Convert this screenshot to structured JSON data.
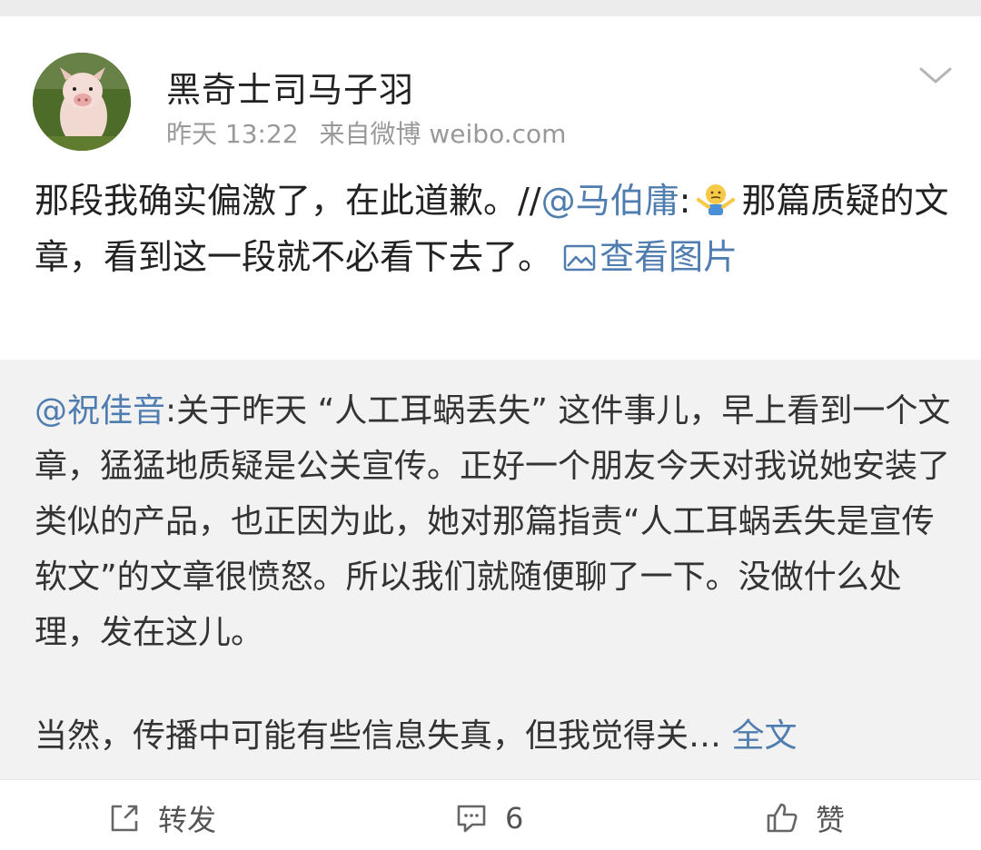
{
  "post": {
    "author": "黑奇士司马子羽",
    "time": "昨天 13:22",
    "source": "来自微博 weibo.com",
    "text_part1": "那段我确实偏激了，在此道歉。//",
    "mention": "@马伯庸",
    "colon": ":",
    "text_part2": "那篇质疑的文章，看到这一段就不必看下去了。",
    "view_image_label": "查看图片"
  },
  "repost": {
    "mention": "@祝佳音",
    "text": ":关于昨天 “人工耳蜗丢失” 这件事儿，早上看到一个文章，猛猛地质疑是公关宣传。正好一个朋友今天对我说她安装了类似的产品，也正因为此，她对那篇指责“人工耳蜗丢失是宣传软文”的文章很愤怒。所以我们就随便聊了一下。没做什么处理，发在这儿。",
    "more_text": "当然，传播中可能有些信息失真，但我觉得关…",
    "full_text_link": "全文"
  },
  "toolbar": {
    "repost_label": "转发",
    "comment_count": "6",
    "like_label": "赞"
  },
  "icons": {
    "chevron": "chevron-down-icon",
    "emoji": "shrug-emoji-icon",
    "picture": "picture-icon",
    "repost": "share-icon",
    "comment": "comment-icon",
    "like": "thumbs-up-icon"
  },
  "colors": {
    "link": "#507daf",
    "meta": "#999999",
    "repost_bg": "#f2f2f2"
  }
}
